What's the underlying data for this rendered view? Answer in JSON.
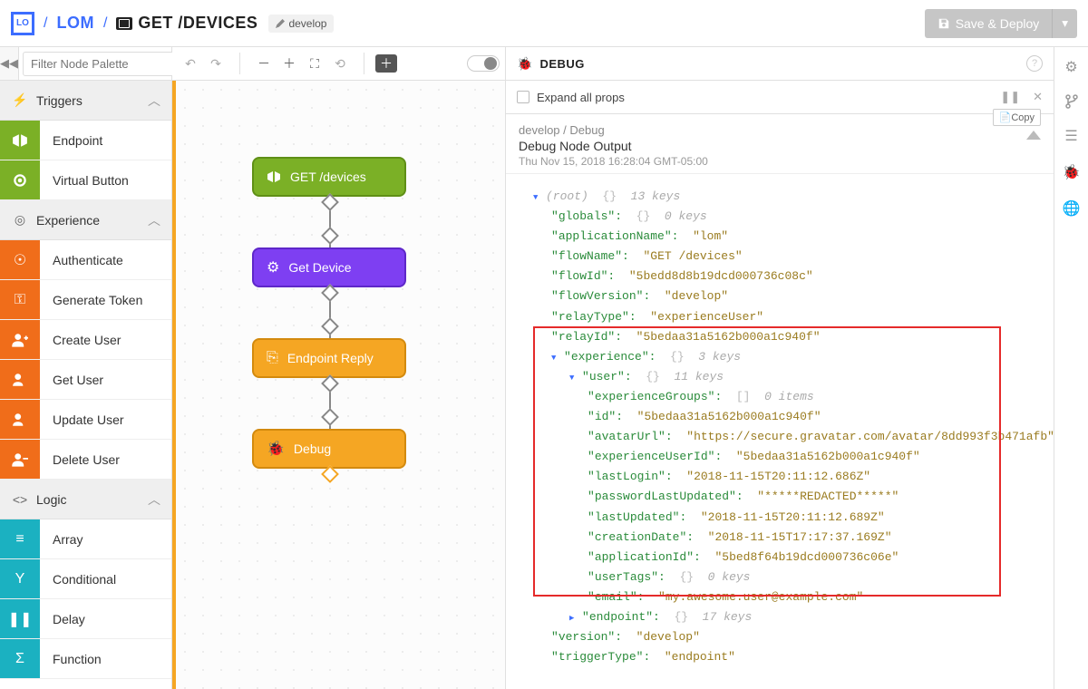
{
  "breadcrumb": {
    "logo": "LO",
    "project": "LOM",
    "flow": "GET /DEVICES",
    "branch": "develop"
  },
  "topbar": {
    "save_label": "Save & Deploy"
  },
  "palette": {
    "filter_placeholder": "Filter Node Palette",
    "categories": {
      "triggers": {
        "label": "Triggers",
        "items": [
          {
            "label": "Endpoint"
          },
          {
            "label": "Virtual Button"
          }
        ]
      },
      "experience": {
        "label": "Experience",
        "items": [
          {
            "label": "Authenticate"
          },
          {
            "label": "Generate Token"
          },
          {
            "label": "Create User"
          },
          {
            "label": "Get User"
          },
          {
            "label": "Update User"
          },
          {
            "label": "Delete User"
          }
        ]
      },
      "logic": {
        "label": "Logic",
        "items": [
          {
            "label": "Array"
          },
          {
            "label": "Conditional"
          },
          {
            "label": "Delay"
          },
          {
            "label": "Function"
          }
        ]
      }
    }
  },
  "canvas_nodes": [
    {
      "label": "GET /devices"
    },
    {
      "label": "Get Device"
    },
    {
      "label": "Endpoint Reply"
    },
    {
      "label": "Debug"
    }
  ],
  "debug": {
    "title": "DEBUG",
    "expand_label": "Expand all props",
    "meta_path": "develop / Debug",
    "meta_title": "Debug Node Output",
    "meta_time": "Thu Nov 15, 2018 16:28:04 GMT-05:00",
    "copy_label": "Copy",
    "root_summary": "13 keys",
    "props": {
      "globals": "0 keys",
      "applicationName": "lom",
      "flowName": "GET /devices",
      "flowId": "5bedd8d8b19dcd000736c08c",
      "flowVersion": "develop",
      "relayType": "experienceUser",
      "relayId": "5bedaa31a5162b000a1c940f",
      "experience_summary": "3 keys",
      "user_summary": "11 keys",
      "user": {
        "experienceGroups": "0 items",
        "id": "5bedaa31a5162b000a1c940f",
        "avatarUrl": "https://secure.gravatar.com/avatar/8dd993f3b471afb",
        "experienceUserId": "5bedaa31a5162b000a1c940f",
        "lastLogin": "2018-11-15T20:11:12.686Z",
        "passwordLastUpdated": "*****REDACTED*****",
        "lastUpdated": "2018-11-15T20:11:12.689Z",
        "creationDate": "2018-11-15T17:17:37.169Z",
        "applicationId": "5bed8f64b19dcd000736c06e",
        "userTags": "0 keys",
        "email": "my.awesome.user@example.com"
      },
      "endpoint_summary": "17 keys",
      "version": "develop",
      "triggerType": "endpoint"
    }
  }
}
